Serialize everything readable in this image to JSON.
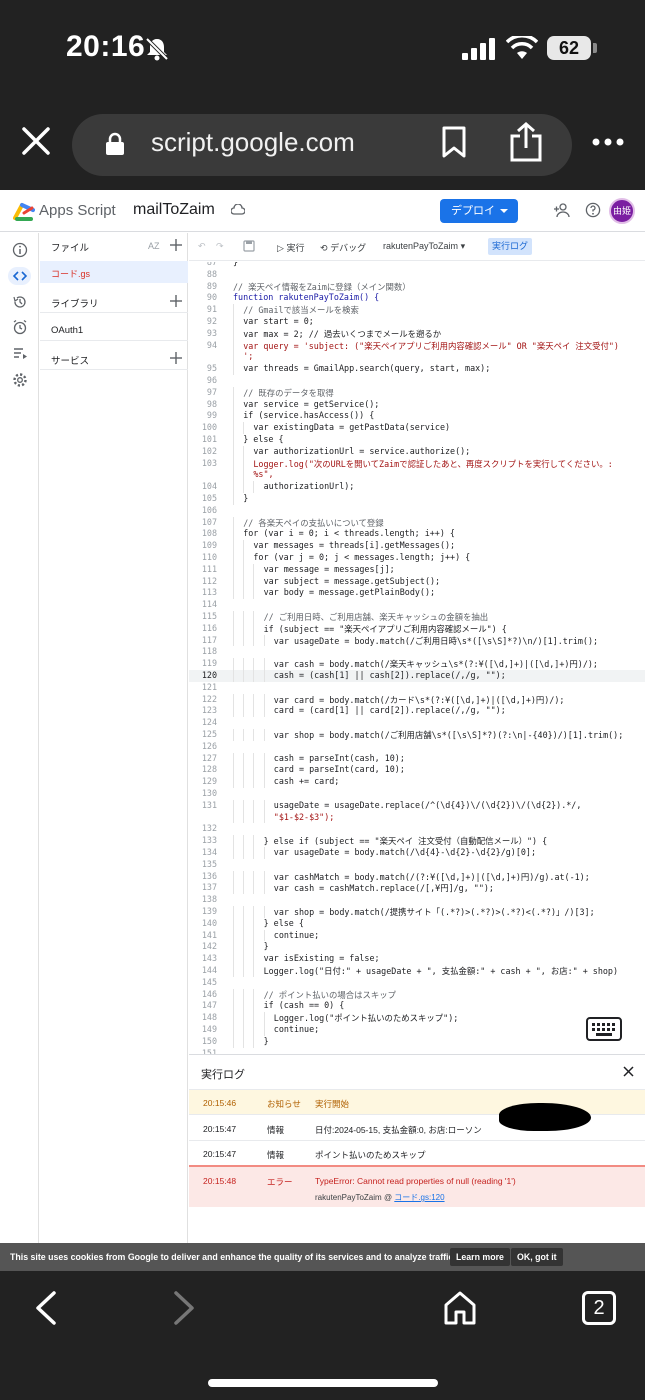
{
  "status": {
    "time": "20:16",
    "battery": "62"
  },
  "browser": {
    "url": "script.google.com",
    "tab_count": "2"
  },
  "topbar": {
    "app_name": "Apps Script",
    "project": "mailToZaim",
    "deploy_label": "デプロイ",
    "avatar_text": "由姫"
  },
  "sidebar": {
    "files_label": "ファイル",
    "sort_label": "AZ",
    "file": "コード.gs",
    "libraries_label": "ライブラリ",
    "oauth_label": "OAuth1",
    "services_label": "サービス"
  },
  "toolbar": {
    "run_label": "実行",
    "debug_label": "デバッグ",
    "function_select": "rakutenPayToZaim",
    "log_label": "実行ログ"
  },
  "editor": {
    "current_line": "120",
    "lines": [
      {
        "n": "87",
        "indent": 0,
        "text": "}"
      },
      {
        "n": "88",
        "indent": 0,
        "text": ""
      },
      {
        "n": "89",
        "indent": 0,
        "text": "// 楽天ペイ情報をZaimに登録（メイン関数）",
        "color": "#5f6368"
      },
      {
        "n": "90",
        "indent": 0,
        "text": "function rakutenPayToZaim() {",
        "color": "#1a1aa6"
      },
      {
        "n": "91",
        "indent": 1,
        "text": "// Gmailで該当メールを検索",
        "color": "#5f6368"
      },
      {
        "n": "92",
        "indent": 1,
        "text": "var start = 0;"
      },
      {
        "n": "93",
        "indent": 1,
        "text": "var max = 2; // 過去いくつまでメールを遡るか"
      },
      {
        "n": "94",
        "indent": 1,
        "text": "var query = 'subject: (\"楽天ペイアプリご利用内容確認メール\" OR \"楽天ペイ 注文受付\")",
        "color": "#a31515"
      },
      {
        "n": "",
        "indent": 1,
        "text": "';",
        "color": "#a31515"
      },
      {
        "n": "95",
        "indent": 1,
        "text": "var threads = GmailApp.search(query, start, max);"
      },
      {
        "n": "96",
        "indent": 0,
        "text": ""
      },
      {
        "n": "97",
        "indent": 1,
        "text": "// 既存のデータを取得",
        "color": "#5f6368"
      },
      {
        "n": "98",
        "indent": 1,
        "text": "var service = getService();"
      },
      {
        "n": "99",
        "indent": 1,
        "text": "if (service.hasAccess()) {"
      },
      {
        "n": "100",
        "indent": 2,
        "text": "var existingData = getPastData(service)"
      },
      {
        "n": "101",
        "indent": 1,
        "text": "} else {"
      },
      {
        "n": "102",
        "indent": 2,
        "text": "var authorizationUrl = service.authorize();"
      },
      {
        "n": "103",
        "indent": 2,
        "text": "Logger.log(\"次のURLを開いてZaimで認証したあと、再度スクリプトを実行してください。:",
        "color": "#a31515"
      },
      {
        "n": "",
        "indent": 2,
        "text": "%s\",",
        "color": "#a31515"
      },
      {
        "n": "104",
        "indent": 3,
        "text": "authorizationUrl);"
      },
      {
        "n": "105",
        "indent": 1,
        "text": "}"
      },
      {
        "n": "106",
        "indent": 0,
        "text": ""
      },
      {
        "n": "107",
        "indent": 1,
        "text": "// 各楽天ペイの支払いについて登録",
        "color": "#5f6368"
      },
      {
        "n": "108",
        "indent": 1,
        "text": "for (var i = 0; i < threads.length; i++) {"
      },
      {
        "n": "109",
        "indent": 2,
        "text": "var messages = threads[i].getMessages();"
      },
      {
        "n": "110",
        "indent": 2,
        "text": "for (var j = 0; j < messages.length; j++) {"
      },
      {
        "n": "111",
        "indent": 3,
        "text": "var message = messages[j];"
      },
      {
        "n": "112",
        "indent": 3,
        "text": "var subject = message.getSubject();"
      },
      {
        "n": "113",
        "indent": 3,
        "text": "var body = message.getPlainBody();"
      },
      {
        "n": "114",
        "indent": 0,
        "text": ""
      },
      {
        "n": "115",
        "indent": 3,
        "text": "// ご利用日時、ご利用店舗、楽天キャッシュの金額を抽出",
        "color": "#5f6368"
      },
      {
        "n": "116",
        "indent": 3,
        "text": "if (subject == \"楽天ペイアプリご利用内容確認メール\") {"
      },
      {
        "n": "117",
        "indent": 4,
        "text": "var usageDate = body.match(/ご利用日時\\s*([\\s\\S]*?)\\n/)[1].trim();"
      },
      {
        "n": "118",
        "indent": 0,
        "text": ""
      },
      {
        "n": "119",
        "indent": 4,
        "text": "var cash = body.match(/楽天キャッシュ\\s*(?:¥([\\d,]+)|([\\d,]+)円)/);"
      },
      {
        "n": "120",
        "indent": 4,
        "text": "cash = (cash[1] || cash[2]).replace(/,/g, \"\");"
      },
      {
        "n": "121",
        "indent": 0,
        "text": ""
      },
      {
        "n": "122",
        "indent": 4,
        "text": "var card = body.match(/カード\\s*(?:¥([\\d,]+)|([\\d,]+)円)/);"
      },
      {
        "n": "123",
        "indent": 4,
        "text": "card = (card[1] || card[2]).replace(/,/g, \"\");"
      },
      {
        "n": "124",
        "indent": 0,
        "text": ""
      },
      {
        "n": "125",
        "indent": 4,
        "text": "var shop = body.match(/ご利用店舗\\s*([\\s\\S]*?)(?:\\n|-{40})/)[1].trim();"
      },
      {
        "n": "126",
        "indent": 0,
        "text": ""
      },
      {
        "n": "127",
        "indent": 4,
        "text": "cash = parseInt(cash, 10);"
      },
      {
        "n": "128",
        "indent": 4,
        "text": "card = parseInt(card, 10);"
      },
      {
        "n": "129",
        "indent": 4,
        "text": "cash += card;"
      },
      {
        "n": "130",
        "indent": 0,
        "text": ""
      },
      {
        "n": "131",
        "indent": 4,
        "text": "usageDate = usageDate.replace(/^(\\d{4})\\/(\\d{2})\\/(\\d{2}).*/,"
      },
      {
        "n": "",
        "indent": 4,
        "text": "\"$1-$2-$3\");",
        "color": "#a31515"
      },
      {
        "n": "132",
        "indent": 0,
        "text": ""
      },
      {
        "n": "133",
        "indent": 3,
        "text": "} else if (subject == \"楽天ペイ 注文受付（自動配信メール）\") {"
      },
      {
        "n": "134",
        "indent": 4,
        "text": "var usageDate = body.match(/\\d{4}-\\d{2}-\\d{2}/g)[0];"
      },
      {
        "n": "135",
        "indent": 0,
        "text": ""
      },
      {
        "n": "136",
        "indent": 4,
        "text": "var cashMatch = body.match(/(?:¥([\\d,]+)|([\\d,]+)円)/g).at(-1);"
      },
      {
        "n": "137",
        "indent": 4,
        "text": "var cash = cashMatch.replace(/[,¥円]/g, \"\");"
      },
      {
        "n": "138",
        "indent": 0,
        "text": ""
      },
      {
        "n": "139",
        "indent": 4,
        "text": "var shop = body.match(/提携サイト「(.*?)>(.*?)>(.*?)<(.*?)」/)[3];"
      },
      {
        "n": "140",
        "indent": 3,
        "text": "} else {"
      },
      {
        "n": "141",
        "indent": 4,
        "text": "continue;"
      },
      {
        "n": "142",
        "indent": 3,
        "text": "}"
      },
      {
        "n": "143",
        "indent": 3,
        "text": "var isExisting = false;"
      },
      {
        "n": "144",
        "indent": 3,
        "text": "Logger.log(\"日付:\" + usageDate + \", 支払金額:\" + cash + \", お店:\" + shop)"
      },
      {
        "n": "145",
        "indent": 0,
        "text": ""
      },
      {
        "n": "146",
        "indent": 3,
        "text": "// ポイント払いの場合はスキップ",
        "color": "#5f6368"
      },
      {
        "n": "147",
        "indent": 3,
        "text": "if (cash == 0) {"
      },
      {
        "n": "148",
        "indent": 4,
        "text": "Logger.log(\"ポイント払いのためスキップ\");"
      },
      {
        "n": "149",
        "indent": 4,
        "text": "continue;"
      },
      {
        "n": "150",
        "indent": 3,
        "text": "}"
      },
      {
        "n": "151",
        "indent": 0,
        "text": ""
      }
    ]
  },
  "log": {
    "title": "実行ログ",
    "rows": [
      {
        "time": "20:15:46",
        "level": "お知らせ",
        "message": "実行開始",
        "type": "notice"
      },
      {
        "time": "20:15:47",
        "level": "情報",
        "message": "日付:2024-05-15, 支払金額:0, お店:ローソン",
        "type": "info"
      },
      {
        "time": "20:15:47",
        "level": "情報",
        "message": "ポイント払いのためスキップ",
        "type": "info"
      },
      {
        "time": "20:15:48",
        "level": "エラー",
        "message": "TypeError: Cannot read properties of null (reading '1')",
        "type": "error",
        "trace_fn": "rakutenPayToZaim",
        "trace_sep": "@",
        "trace_link": "コード.gs:120"
      }
    ]
  },
  "cookie": {
    "text": "This site uses cookies from Google to deliver and enhance the quality of its services and to analyze traffic.",
    "learn_more": "Learn more",
    "ok": "OK, got it"
  }
}
